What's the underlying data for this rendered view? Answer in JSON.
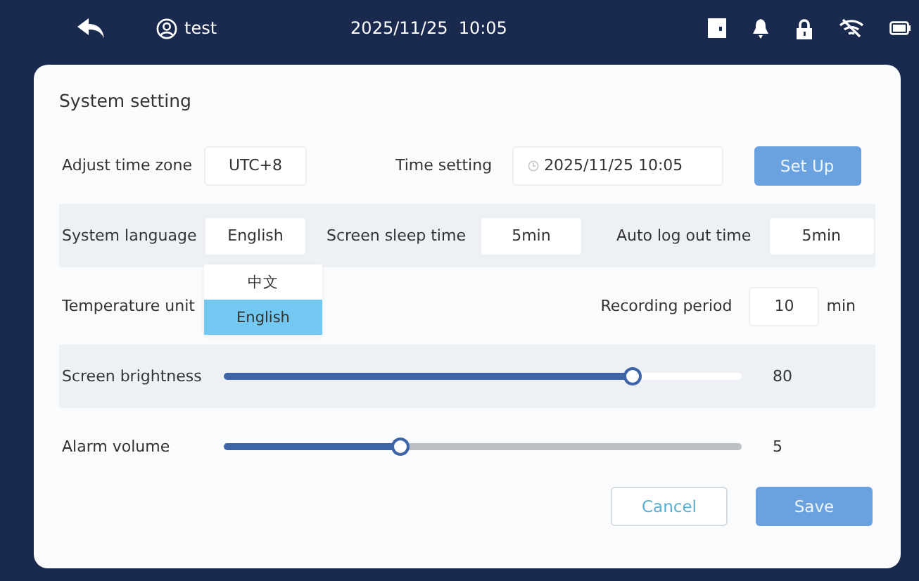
{
  "status_bar": {
    "user": "test",
    "datetime": "2025/11/25  10:05"
  },
  "dialog": {
    "title": "System setting",
    "time_zone": {
      "label": "Adjust time zone",
      "value": "UTC+8"
    },
    "time_setting": {
      "label": "Time setting",
      "value": "2025/11/25 10:05",
      "button": "Set Up"
    },
    "language": {
      "label": "System language",
      "value": "English",
      "dropdown": [
        {
          "label": "中文",
          "selected": false
        },
        {
          "label": "English",
          "selected": true
        }
      ]
    },
    "sleep_time": {
      "label": "Screen sleep time",
      "value": "5min"
    },
    "logout_time": {
      "label": "Auto log out time",
      "value": "5min"
    },
    "temperature_unit": {
      "label": "Temperature unit"
    },
    "recording_period": {
      "label": "Recording period",
      "value": "10",
      "unit": "min"
    },
    "sliders": [
      {
        "label": "Screen brightness",
        "level": 0.79,
        "reading": "80"
      },
      {
        "label": "Alarm volume",
        "level": 0.34,
        "reading": "5"
      }
    ],
    "buttons": [
      {
        "kind": "secondary",
        "label": "Cancel"
      },
      {
        "kind": "primary",
        "label": "Save"
      }
    ]
  }
}
